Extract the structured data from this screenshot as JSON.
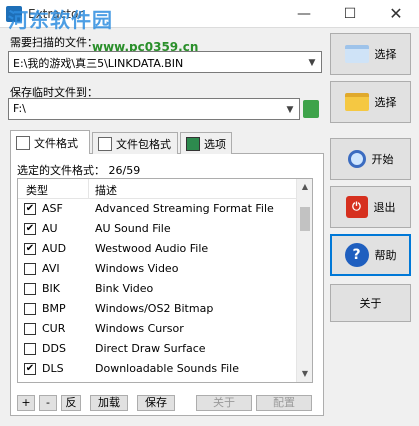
{
  "window": {
    "title": "Extractor",
    "watermark": "河东软件园",
    "watermark_url": "www.pc0359.cn",
    "minimize": "—",
    "maximize": "☐",
    "close": "✕"
  },
  "source": {
    "label": "需要扫描的文件：",
    "value": "E:\\我的游戏\\真三5\\LINKDATA.BIN",
    "button": "选择"
  },
  "temp": {
    "label": "保存临时文件到：",
    "value": "F:\\",
    "button": "选择"
  },
  "actions": {
    "start": "开始",
    "exit": "退出",
    "help": "帮助",
    "about": "关于"
  },
  "tabs": [
    {
      "label": "文件格式"
    },
    {
      "label": "文件包格式"
    },
    {
      "label": "选项"
    }
  ],
  "selected_count": {
    "label": "选定的文件格式：",
    "value": "26/59"
  },
  "list": {
    "col_type": "类型",
    "col_desc": "描述",
    "rows": [
      {
        "checked": true,
        "check": "✔",
        "ext": "ASF",
        "desc": "Advanced Streaming Format File"
      },
      {
        "checked": true,
        "check": "✔",
        "ext": "AU",
        "desc": "AU Sound File"
      },
      {
        "checked": true,
        "check": "✔",
        "ext": "AUD",
        "desc": "Westwood Audio File"
      },
      {
        "checked": false,
        "check": "",
        "ext": "AVI",
        "desc": "Windows Video"
      },
      {
        "checked": false,
        "check": "",
        "ext": "BIK",
        "desc": "Bink Video"
      },
      {
        "checked": false,
        "check": "",
        "ext": "BMP",
        "desc": "Windows/OS2 Bitmap"
      },
      {
        "checked": false,
        "check": "",
        "ext": "CUR",
        "desc": "Windows Cursor"
      },
      {
        "checked": false,
        "check": "",
        "ext": "DDS",
        "desc": "Direct Draw Surface"
      },
      {
        "checked": true,
        "check": "✔",
        "ext": "DLS",
        "desc": "Downloadable Sounds File"
      }
    ]
  },
  "bottom_buttons": {
    "plus": "+",
    "minus": "-",
    "invert": "反",
    "load": "加载",
    "save": "保存",
    "about": "关于",
    "config": "配置"
  }
}
